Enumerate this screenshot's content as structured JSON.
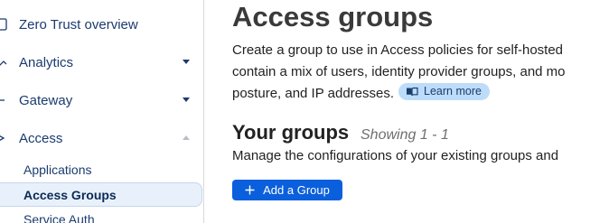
{
  "sidebar": {
    "items": [
      {
        "label": "Zero Trust overview",
        "icon": "document-icon"
      },
      {
        "label": "Analytics",
        "icon": "chart-icon",
        "expanded": false
      },
      {
        "label": "Gateway",
        "icon": "gateway-icon",
        "expanded": false
      },
      {
        "label": "Access",
        "icon": "access-icon",
        "expanded": true
      }
    ],
    "access_subitems": [
      {
        "label": "Applications"
      },
      {
        "label": "Access Groups",
        "active": true
      },
      {
        "label": "Service Auth"
      }
    ]
  },
  "main": {
    "title": "Access groups",
    "description_lines": [
      "Create a group to use in Access policies for self-hosted",
      "contain a mix of users, identity provider groups, and mo",
      "posture, and IP addresses."
    ],
    "learn_more_label": "Learn more",
    "groups_section": {
      "title": "Your groups",
      "showing": "Showing 1 - 1",
      "description": "Manage the configurations of your existing groups and",
      "add_button_label": "Add a Group"
    }
  },
  "colors": {
    "accent": "#0a5fdc",
    "nav_text": "#1b3b6f",
    "learn_more_bg": "#bcdcf9",
    "active_item_bg": "#e8f1fb"
  }
}
